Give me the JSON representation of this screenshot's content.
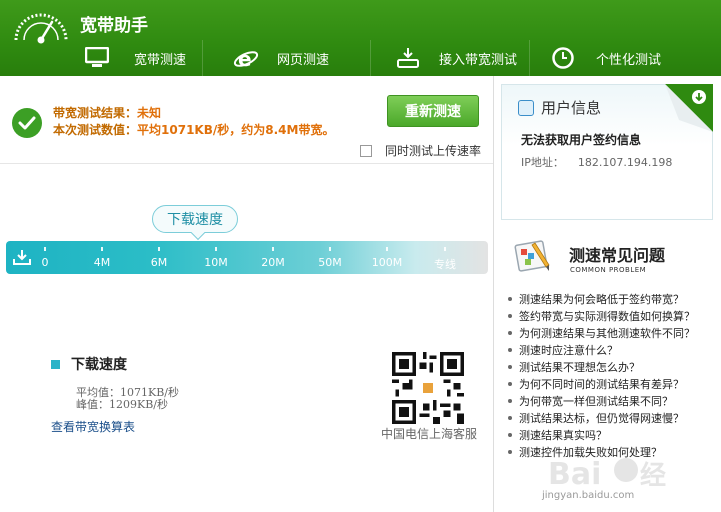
{
  "app": {
    "title": "宽带助手"
  },
  "nav": [
    {
      "label": "宽带测速",
      "icon": "monitor-icon"
    },
    {
      "label": "网页测速",
      "icon": "ie-icon"
    },
    {
      "label": "接入带宽测试",
      "icon": "router-icon"
    },
    {
      "label": "个性化测试",
      "icon": "clock-icon"
    }
  ],
  "result": {
    "line1_label": "带宽测试结果：",
    "line1_value": "未知",
    "line2_label": "本次测试数值：",
    "line2_value": "平均1071KB/秒，约为8.4M带宽。",
    "retest_label": "重新测速",
    "upload_label": "同时测试上传速率",
    "upload_checked": false
  },
  "speed_bar": {
    "bubble_label": "下载速度",
    "ticks": [
      "0",
      "4M",
      "6M",
      "10M",
      "20M",
      "50M",
      "100M",
      "专线"
    ]
  },
  "download": {
    "title": "下载速度",
    "avg": "平均值：1071KB/秒",
    "peak": "峰值：1209KB/秒",
    "conversion_link": "查看带宽换算表"
  },
  "qr": {
    "caption": "中国电信上海客服"
  },
  "user_info": {
    "title": "用户信息",
    "message": "无法获取用户签约信息",
    "ip_label": "IP地址：",
    "ip_value": "182.107.194.198"
  },
  "faq": {
    "title": "测速常见问题",
    "subtitle": "COMMON PROBLEM",
    "items": [
      "测速结果为何会略低于签约带宽？",
      "签约带宽与实际测得数值如何换算？",
      "为何测速结果与其他测速软件不同？",
      "测速时应注意什么？",
      "测试结果不理想怎么办？",
      "为何不同时间的测试结果有差异？",
      "为何带宽一样但测试结果不同？",
      "测试结果达标，但仍觉得网速慢？",
      "测速结果真实吗？",
      "测速控件加载失败如何处理？"
    ]
  },
  "watermark": {
    "text": "jingyan.baidu.com"
  },
  "colors": {
    "header": "#2f8a10",
    "accent": "#4ba82a",
    "bar": "#1eb3c3",
    "result_text": "#c26a00"
  }
}
